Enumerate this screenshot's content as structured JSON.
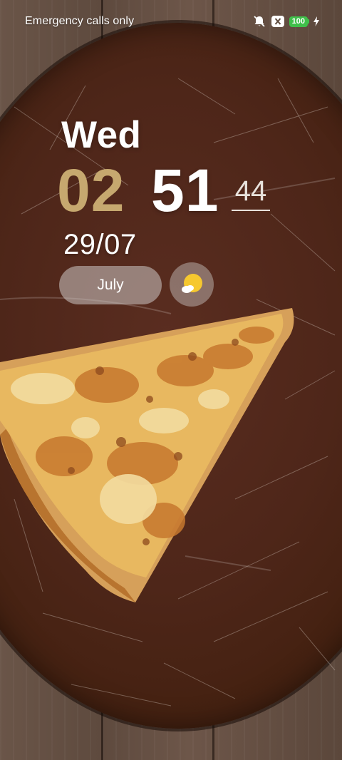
{
  "status_bar": {
    "carrier_text": "Emergency calls only",
    "icons": [
      "ring-muted-icon",
      "no-sim-icon",
      "battery-icon",
      "charging-bolt-icon"
    ],
    "battery_level": "100",
    "battery_color": "#3fbf4a"
  },
  "clock": {
    "day": "Wed",
    "hour": "02",
    "minute": "51",
    "seconds": "44",
    "date": "29/07",
    "hour_color": "#c6a86f"
  },
  "widgets": {
    "month_label": "July",
    "weather_icon": "sunny-partly-cloudy-icon",
    "sun_color": "#f6c82f"
  },
  "wallpaper": {
    "subject": "pizza-slice-on-wooden-board"
  }
}
